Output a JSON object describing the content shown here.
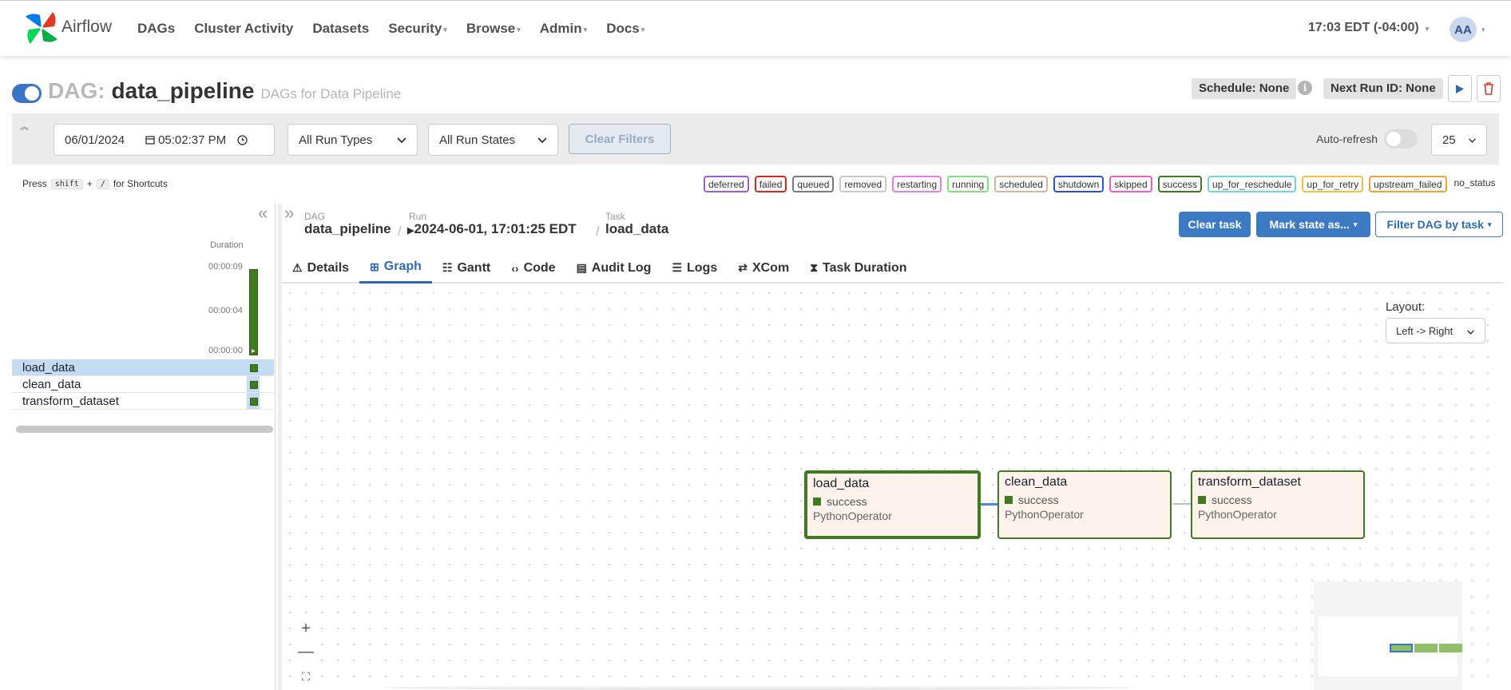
{
  "nav": {
    "brand": "Airflow",
    "items": [
      {
        "label": "DAGs",
        "dropdown": false
      },
      {
        "label": "Cluster Activity",
        "dropdown": false
      },
      {
        "label": "Datasets",
        "dropdown": false
      },
      {
        "label": "Security",
        "dropdown": true
      },
      {
        "label": "Browse",
        "dropdown": true
      },
      {
        "label": "Admin",
        "dropdown": true
      },
      {
        "label": "Docs",
        "dropdown": true
      }
    ],
    "time": "17:03 EDT (-04:00)",
    "avatar": "AA"
  },
  "dag": {
    "prefix": "DAG:",
    "name": "data_pipeline",
    "description": "DAGs for Data Pipeline",
    "schedule": "Schedule: None",
    "next_run": "Next Run ID: None"
  },
  "filters": {
    "date": "06/01/2024",
    "time": "05:02:37 PM",
    "run_types": "All Run Types",
    "run_states": "All Run States",
    "clear_filters": "Clear Filters",
    "auto_refresh": "Auto-refresh",
    "page_size": "25"
  },
  "shortcuts": {
    "press": "Press",
    "key1": "shift",
    "plus": "+",
    "key2": "/",
    "suffix": "for Shortcuts"
  },
  "legend": [
    {
      "label": "deferred",
      "color": "#9b5cd6"
    },
    {
      "label": "failed",
      "color": "#e0251f"
    },
    {
      "label": "queued",
      "color": "#7a7a7a"
    },
    {
      "label": "removed",
      "color": "#c9c9c9"
    },
    {
      "label": "restarting",
      "color": "#e87ce8"
    },
    {
      "label": "running",
      "color": "#7fe07f"
    },
    {
      "label": "scheduled",
      "color": "#d6b59a"
    },
    {
      "label": "shutdown",
      "color": "#2f4fd6"
    },
    {
      "label": "skipped",
      "color": "#e85fc2"
    },
    {
      "label": "success",
      "color": "#3f7c20"
    },
    {
      "label": "up_for_reschedule",
      "color": "#6fd7d7"
    },
    {
      "label": "up_for_retry",
      "color": "#f2c23a"
    },
    {
      "label": "upstream_failed",
      "color": "#f2a03a"
    },
    {
      "label": "no_status",
      "color": ""
    }
  ],
  "grid": {
    "duration_label": "Duration",
    "ticks": [
      "00:00:09",
      "00:00:04",
      "00:00:00"
    ],
    "tasks": [
      "load_data",
      "clean_data",
      "transform_dataset"
    ]
  },
  "breadcrumb": {
    "dag_label": "DAG",
    "dag_value": "data_pipeline",
    "run_label": "Run",
    "run_value": "2024-06-01, 17:01:25 EDT",
    "task_label": "Task",
    "task_value": "load_data"
  },
  "actions": {
    "clear_task": "Clear task",
    "mark_state": "Mark state as...",
    "filter_dag": "Filter DAG by task"
  },
  "tabs": [
    {
      "label": "Details",
      "icon": "warning-icon",
      "glyph": "⚠"
    },
    {
      "label": "Graph",
      "icon": "graph-icon",
      "glyph": "⊞",
      "active": true
    },
    {
      "label": "Gantt",
      "icon": "gantt-icon",
      "glyph": "☷"
    },
    {
      "label": "Code",
      "icon": "code-icon",
      "glyph": "‹›"
    },
    {
      "label": "Audit Log",
      "icon": "document-icon",
      "glyph": "🗎"
    },
    {
      "label": "Logs",
      "icon": "list-icon",
      "glyph": "☰"
    },
    {
      "label": "XCom",
      "icon": "exchange-icon",
      "glyph": "⇄"
    },
    {
      "label": "Task Duration",
      "icon": "hourglass-icon",
      "glyph": "⧗"
    }
  ],
  "graph": {
    "layout_label": "Layout:",
    "layout_value": "Left -> Right",
    "nodes": [
      {
        "name": "load_data",
        "state": "success",
        "operator": "PythonOperator"
      },
      {
        "name": "clean_data",
        "state": "success",
        "operator": "PythonOperator"
      },
      {
        "name": "transform_dataset",
        "state": "success",
        "operator": "PythonOperator"
      }
    ]
  }
}
